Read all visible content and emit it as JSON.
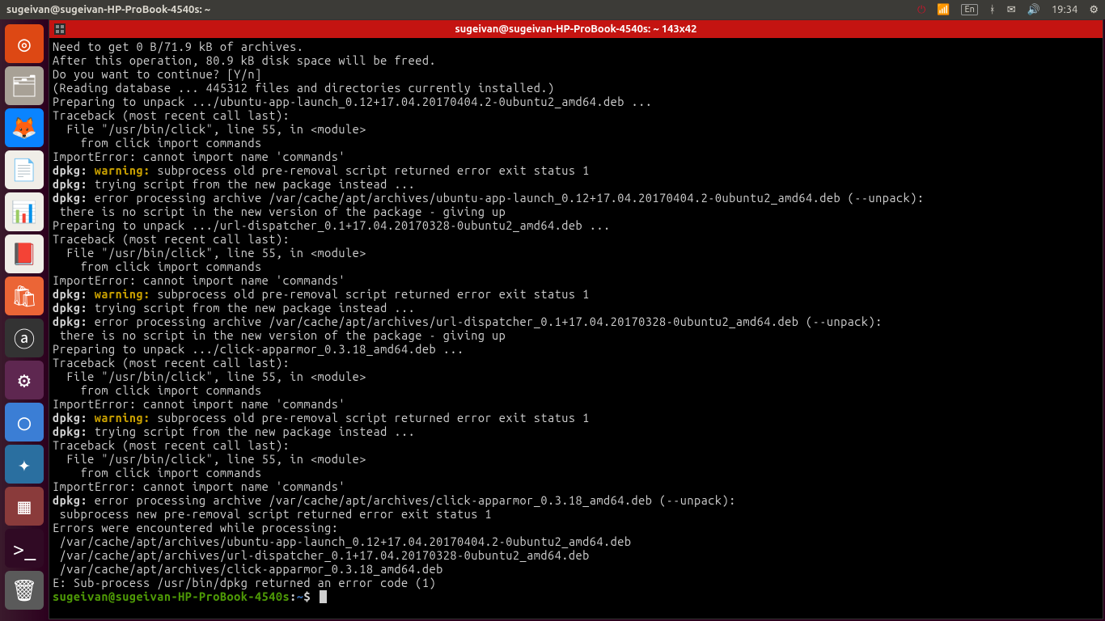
{
  "top_panel": {
    "title": "sugeivan@sugeivan-HP-ProBook-4540s: ~",
    "lang": "En",
    "time": "19:34"
  },
  "launcher": {
    "items": [
      {
        "name": "dash",
        "bg": "#dd4814",
        "glyph": "◎"
      },
      {
        "name": "files",
        "bg": "#a8a196",
        "glyph": "🗂"
      },
      {
        "name": "firefox",
        "bg": "#0a84ff",
        "glyph": "🦊"
      },
      {
        "name": "writer",
        "bg": "#f0eee8",
        "glyph": "📄"
      },
      {
        "name": "calc",
        "bg": "#f0eee8",
        "glyph": "📊"
      },
      {
        "name": "impress",
        "bg": "#f0eee8",
        "glyph": "📕"
      },
      {
        "name": "software",
        "bg": "#eb6536",
        "glyph": "🛍"
      },
      {
        "name": "amazon",
        "bg": "#333333",
        "glyph": "ⓐ"
      },
      {
        "name": "settings",
        "bg": "#5e2750",
        "glyph": "⚙"
      },
      {
        "name": "chromium",
        "bg": "#3b7ed5",
        "glyph": "◯"
      },
      {
        "name": "wallpaper",
        "bg": "#2a6fa0",
        "glyph": "✦"
      },
      {
        "name": "desktops",
        "bg": "#8a3b3b",
        "glyph": "▦"
      },
      {
        "name": "terminal",
        "bg": "#300a24",
        "glyph": ">_"
      },
      {
        "name": "trash",
        "bg": "#5a5a5a",
        "glyph": "🗑"
      }
    ]
  },
  "terminal": {
    "title": "sugeivan@sugeivan-HP-ProBook-4540s: ~ 143x42",
    "prompt": {
      "user_host": "sugeivan@sugeivan-HP-ProBook-4540s",
      "sep": ":",
      "path": "~",
      "suffix": "$"
    },
    "lines": [
      {
        "t": "Need to get 0 B/71.9 kB of archives."
      },
      {
        "t": "After this operation, 80.9 kB disk space will be freed."
      },
      {
        "t": "Do you want to continue? [Y/n]"
      },
      {
        "t": "(Reading database ... 445312 files and directories currently installed.)"
      },
      {
        "t": "Preparing to unpack .../ubuntu-app-launch_0.12+17.04.20170404.2-0ubuntu2_amd64.deb ..."
      },
      {
        "t": "Traceback (most recent call last):"
      },
      {
        "t": "  File \"/usr/bin/click\", line 55, in <module>"
      },
      {
        "t": "    from click import commands"
      },
      {
        "t": "ImportError: cannot import name 'commands'"
      },
      {
        "seg": [
          {
            "c": "dpkg",
            "t": "dpkg: "
          },
          {
            "c": "warning",
            "t": "warning:"
          },
          {
            "c": "",
            "t": " subprocess old pre-removal script returned error exit status 1"
          }
        ]
      },
      {
        "seg": [
          {
            "c": "dpkg",
            "t": "dpkg:"
          },
          {
            "c": "",
            "t": " trying script from the new package instead ..."
          }
        ]
      },
      {
        "seg": [
          {
            "c": "dpkg",
            "t": "dpkg:"
          },
          {
            "c": "",
            "t": " error processing archive /var/cache/apt/archives/ubuntu-app-launch_0.12+17.04.20170404.2-0ubuntu2_amd64.deb (--unpack):"
          }
        ]
      },
      {
        "t": " there is no script in the new version of the package - giving up"
      },
      {
        "t": "Preparing to unpack .../url-dispatcher_0.1+17.04.20170328-0ubuntu2_amd64.deb ..."
      },
      {
        "t": "Traceback (most recent call last):"
      },
      {
        "t": "  File \"/usr/bin/click\", line 55, in <module>"
      },
      {
        "t": "    from click import commands"
      },
      {
        "t": "ImportError: cannot import name 'commands'"
      },
      {
        "seg": [
          {
            "c": "dpkg",
            "t": "dpkg: "
          },
          {
            "c": "warning",
            "t": "warning:"
          },
          {
            "c": "",
            "t": " subprocess old pre-removal script returned error exit status 1"
          }
        ]
      },
      {
        "seg": [
          {
            "c": "dpkg",
            "t": "dpkg:"
          },
          {
            "c": "",
            "t": " trying script from the new package instead ..."
          }
        ]
      },
      {
        "seg": [
          {
            "c": "dpkg",
            "t": "dpkg:"
          },
          {
            "c": "",
            "t": " error processing archive /var/cache/apt/archives/url-dispatcher_0.1+17.04.20170328-0ubuntu2_amd64.deb (--unpack):"
          }
        ]
      },
      {
        "t": " there is no script in the new version of the package - giving up"
      },
      {
        "t": "Preparing to unpack .../click-apparmor_0.3.18_amd64.deb ..."
      },
      {
        "t": "Traceback (most recent call last):"
      },
      {
        "t": "  File \"/usr/bin/click\", line 55, in <module>"
      },
      {
        "t": "    from click import commands"
      },
      {
        "t": "ImportError: cannot import name 'commands'"
      },
      {
        "seg": [
          {
            "c": "dpkg",
            "t": "dpkg: "
          },
          {
            "c": "warning",
            "t": "warning:"
          },
          {
            "c": "",
            "t": " subprocess old pre-removal script returned error exit status 1"
          }
        ]
      },
      {
        "seg": [
          {
            "c": "dpkg",
            "t": "dpkg:"
          },
          {
            "c": "",
            "t": " trying script from the new package instead ..."
          }
        ]
      },
      {
        "t": "Traceback (most recent call last):"
      },
      {
        "t": "  File \"/usr/bin/click\", line 55, in <module>"
      },
      {
        "t": "    from click import commands"
      },
      {
        "t": "ImportError: cannot import name 'commands'"
      },
      {
        "seg": [
          {
            "c": "dpkg",
            "t": "dpkg:"
          },
          {
            "c": "",
            "t": " error processing archive /var/cache/apt/archives/click-apparmor_0.3.18_amd64.deb (--unpack):"
          }
        ]
      },
      {
        "t": " subprocess new pre-removal script returned error exit status 1"
      },
      {
        "t": "Errors were encountered while processing:"
      },
      {
        "t": " /var/cache/apt/archives/ubuntu-app-launch_0.12+17.04.20170404.2-0ubuntu2_amd64.deb"
      },
      {
        "t": " /var/cache/apt/archives/url-dispatcher_0.1+17.04.20170328-0ubuntu2_amd64.deb"
      },
      {
        "t": " /var/cache/apt/archives/click-apparmor_0.3.18_amd64.deb"
      },
      {
        "t": "E: Sub-process /usr/bin/dpkg returned an error code (1)"
      }
    ]
  }
}
